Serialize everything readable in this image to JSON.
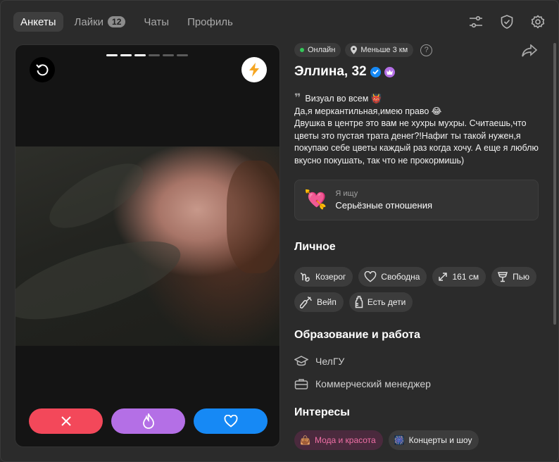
{
  "nav": {
    "tabs": [
      {
        "label": "Анкеты"
      },
      {
        "label": "Лайки",
        "badge": "12"
      },
      {
        "label": "Чаты"
      },
      {
        "label": "Профиль"
      }
    ],
    "icons": [
      "filters-icon",
      "shield-icon",
      "settings-icon"
    ]
  },
  "card": {
    "photo_count": 6,
    "photo_index": 3,
    "buttons": [
      "rewind-icon",
      "boost-icon",
      "dislike-icon",
      "superlike-fire-icon",
      "like-heart-icon"
    ],
    "colors": {
      "dislike": "#f3485a",
      "superlike": "#b46fe6",
      "like": "#1689f5"
    }
  },
  "profile": {
    "status": "Онлайн",
    "distance": "Меньше 3 км",
    "help": "?",
    "name_age": "Эллина, 32",
    "bio_lines": [
      "Визуал во всем 👹",
      "Да,я меркантильная,имею право 😂",
      "Двушка в центре это вам не хухры мухры. Считаешь,что цветы это пустая трата денег?!Нафиг ты такой нужен,я покупаю себе цветы каждый раз когда хочу. А еще я люблю вкусно покушать, так что не прокормишь)"
    ],
    "looking_for": {
      "label": "Я ищу",
      "value": "Серьёзные отношения",
      "emoji": "💘"
    }
  },
  "personal": {
    "title": "Личное",
    "tags": [
      {
        "icon": "capricorn-icon",
        "label": "Козерог"
      },
      {
        "icon": "heart-outline-icon",
        "label": "Свободна"
      },
      {
        "icon": "height-icon",
        "label": "161 см"
      },
      {
        "icon": "glass-icon",
        "label": "Пью"
      },
      {
        "icon": "vape-icon",
        "label": "Вейп"
      },
      {
        "icon": "bottle-icon",
        "label": "Есть дети"
      }
    ]
  },
  "education": {
    "title": "Образование и работа",
    "items": [
      {
        "icon": "graduation-cap-icon",
        "label": "ЧелГУ"
      },
      {
        "icon": "briefcase-icon",
        "label": "Коммерческий менеджер"
      }
    ]
  },
  "interests": {
    "title": "Интересы",
    "tags": [
      {
        "emoji": "👜",
        "label": "Мода и красота",
        "color": "#f06fa6"
      },
      {
        "emoji": "🎆",
        "label": "Концерты и шоу"
      }
    ]
  }
}
